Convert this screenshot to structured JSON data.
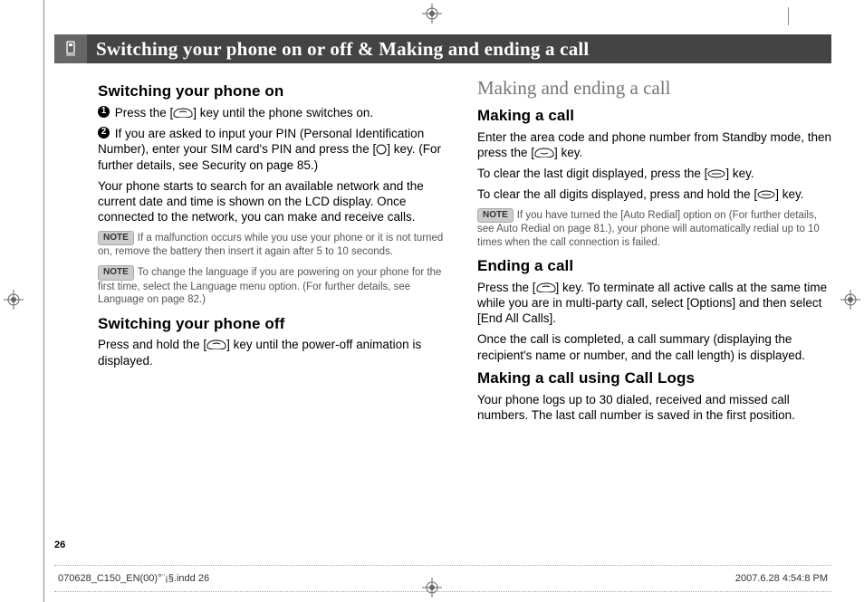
{
  "header": {
    "title": "Switching your phone on or off & Making and ending a call"
  },
  "page_number": "26",
  "left": {
    "h1": "Switching your phone on",
    "step1": "Press the [",
    "step1b": "] key until the phone switches on.",
    "step2": "If you are asked to input your PIN (Personal Identification Number), enter your SIM card's PIN and press the [",
    "step2b": "] key. (For further details, see Security on page 85.)",
    "para1": "Your phone starts to search for an available network and the current date and time is shown on the LCD display. Once connected to the network, you can make and receive calls.",
    "note1_label": "NOTE",
    "note1": "If a malfunction occurs while you use your phone or it is not turned on, remove the battery then insert it again after 5 to 10 seconds.",
    "note2_label": "NOTE",
    "note2": "To change the language if you are powering on your phone for the first time, select the Language menu option. (For further details, see Language on page 82.)",
    "h2": "Switching your phone off",
    "off_a": "Press and hold the [",
    "off_b": "] key until the power-off animation is displayed."
  },
  "right": {
    "serif": "Making and ending a call",
    "h1": "Making a call",
    "p1a": "Enter the area code and phone number from Standby mode, then press the [",
    "p1b": "] key.",
    "p2a": "To clear the last digit displayed, press the [",
    "p2b": "] key.",
    "p3a": "To clear the all digits displayed, press and hold the [",
    "p3b": "] key.",
    "note_label": "NOTE",
    "note": "If you have turned the [Auto Redial] option on (For further details, see Auto Redial on page 81.), your phone will automatically redial up to 10 times when the call connection is failed.",
    "h2": "Ending a call",
    "e1a": "Press the [",
    "e1b": "] key. To terminate all active calls at the same time while you are in multi-party call, select [Options] and then select [End All Calls].",
    "e2": "Once the call is completed, a call summary (displaying the recipient's name or number, and the call length) is displayed.",
    "h3": "Making a call using Call Logs",
    "log": "Your phone logs up to 30 dialed, received and missed call numbers. The last call number is saved in the first position."
  },
  "footer": {
    "left": "070628_C150_EN(00)°¨¡§.indd   26",
    "right": "2007.6.28   4:54:8 PM"
  }
}
